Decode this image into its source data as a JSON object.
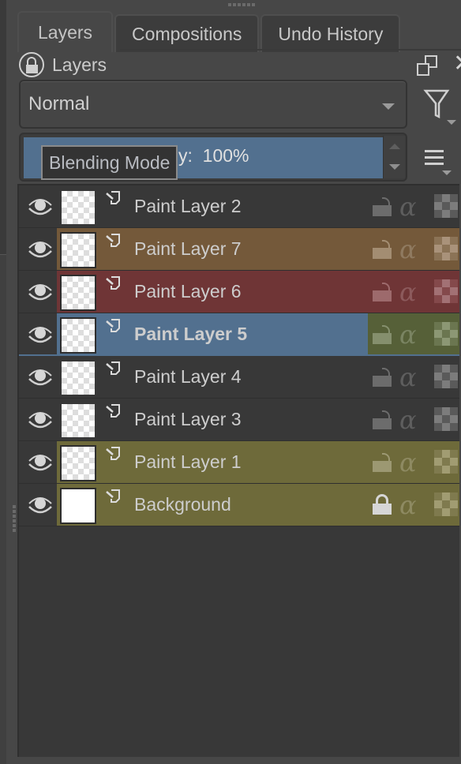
{
  "tabs": [
    {
      "label": "Layers",
      "active": true
    },
    {
      "label": "Compositions",
      "active": false
    },
    {
      "label": "Undo History",
      "active": false
    }
  ],
  "docker": {
    "title": "Layers",
    "lock_icon": "lock-docker-icon",
    "float_icon": "float-window-icon",
    "close_icon": "close-icon"
  },
  "blending": {
    "selected": "Normal",
    "tooltip": "Blending Mode"
  },
  "opacity": {
    "label": "Opacity:",
    "visible_suffix": "y:",
    "value_text": "100%",
    "value": 100
  },
  "toolbar": {
    "filter_icon": "filter-icon",
    "menu_icon": "hamburger-menu-icon"
  },
  "colors": {
    "selection": "#52708f",
    "orange_label": "#74593a",
    "red_label": "#6f3536",
    "green_label": "#566038",
    "yellow_label": "#6e6a3a",
    "list_bg": "#383838"
  },
  "layers": [
    {
      "name": "Paint Layer 2",
      "label_color": "none",
      "selected": false,
      "locked": false,
      "visible": true,
      "thumbnail": "transparent"
    },
    {
      "name": "Paint Layer 7",
      "label_color": "orange",
      "selected": false,
      "locked": false,
      "visible": true,
      "thumbnail": "transparent"
    },
    {
      "name": "Paint Layer 6",
      "label_color": "red",
      "selected": false,
      "locked": false,
      "visible": true,
      "thumbnail": "transparent"
    },
    {
      "name": "Paint Layer 5",
      "label_color": "green",
      "selected": true,
      "locked": false,
      "visible": true,
      "thumbnail": "transparent"
    },
    {
      "name": "Paint Layer 4",
      "label_color": "none",
      "selected": false,
      "locked": false,
      "visible": true,
      "thumbnail": "transparent"
    },
    {
      "name": "Paint Layer 3",
      "label_color": "none",
      "selected": false,
      "locked": false,
      "visible": true,
      "thumbnail": "transparent"
    },
    {
      "name": "Paint Layer 1",
      "label_color": "yellow",
      "selected": false,
      "locked": false,
      "visible": true,
      "thumbnail": "transparent"
    },
    {
      "name": "Background",
      "label_color": "yellow",
      "selected": false,
      "locked": true,
      "visible": true,
      "thumbnail": "white"
    }
  ],
  "alpha_symbol": "α"
}
